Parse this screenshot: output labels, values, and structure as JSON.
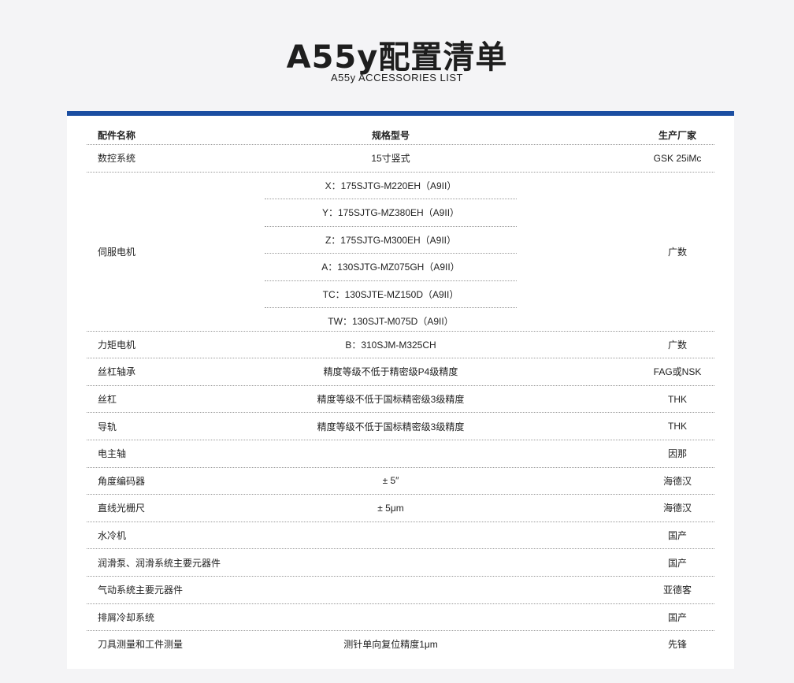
{
  "title": "A55y配置清单",
  "subtitle": "A55y ACCESSORIES LIST",
  "headers": {
    "name": "配件名称",
    "spec": "规格型号",
    "maker": "生产厂家"
  },
  "rows_before": [
    {
      "name": "数控系统",
      "spec": "15寸竖式",
      "maker": "GSK 25iMc"
    }
  ],
  "servo": {
    "name": "伺服电机",
    "maker": "广数",
    "specs": [
      "X：175SJTG-M220EH（A9II）",
      "Y：175SJTG-MZ380EH（A9II）",
      "Z：175SJTG-M300EH（A9II）",
      "A：130SJTG-MZ075GH（A9II）",
      "TC：130SJTE-MZ150D（A9II）",
      "TW：130SJT-M075D（A9II）"
    ]
  },
  "rows_after": [
    {
      "name": "力矩电机",
      "spec": "B：310SJM-M325CH",
      "maker": "广数"
    },
    {
      "name": "丝杠轴承",
      "spec": "精度等级不低于精密级P4级精度",
      "maker": "FAG或NSK"
    },
    {
      "name": "丝杠",
      "spec": "精度等级不低于国标精密级3级精度",
      "maker": "THK"
    },
    {
      "name": "导轨",
      "spec": "精度等级不低于国标精密级3级精度",
      "maker": "THK"
    },
    {
      "name": "电主轴",
      "spec": "",
      "maker": "因那"
    },
    {
      "name": "角度编码器",
      "spec": "± 5″",
      "maker": "海德汉"
    },
    {
      "name": "直线光栅尺",
      "spec": "± 5μm",
      "maker": "海德汉"
    },
    {
      "name": "水冷机",
      "spec": "",
      "maker": "国产"
    },
    {
      "name": "润滑泵、润滑系统主要元器件",
      "spec": "",
      "maker": "国产"
    },
    {
      "name": "气动系统主要元器件",
      "spec": "",
      "maker": "亚德客"
    },
    {
      "name": "排屑冷却系统",
      "spec": "",
      "maker": "国产"
    },
    {
      "name": "刀具测量和工件测量",
      "spec": "测针单向复位精度1μm",
      "maker": "先锋"
    }
  ]
}
